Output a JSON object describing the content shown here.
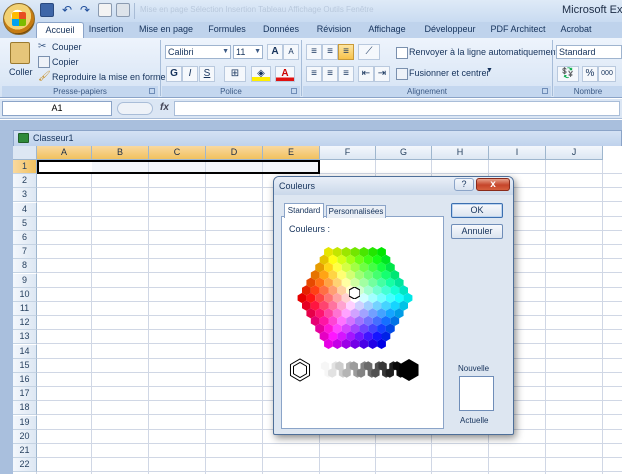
{
  "app": {
    "title": "Microsoft Exce",
    "faded_title": "Mise en page  Sélection  Insertion  Tableau  Affichage  Outils  Fenêtre"
  },
  "tabs": [
    {
      "label": "Accueil",
      "active": true
    },
    {
      "label": "Insertion"
    },
    {
      "label": "Mise en page"
    },
    {
      "label": "Formules"
    },
    {
      "label": "Données"
    },
    {
      "label": "Révision"
    },
    {
      "label": "Affichage"
    },
    {
      "label": "Développeur"
    },
    {
      "label": "PDF Architect"
    },
    {
      "label": "Acrobat"
    }
  ],
  "ribbon": {
    "clipboard": {
      "paste": "Coller",
      "cut": "Couper",
      "copy": "Copier",
      "format_painter": "Reproduire la mise en forme",
      "label": "Presse-papiers"
    },
    "font": {
      "name": "Calibri",
      "size": "11",
      "bold": "G",
      "italic": "I",
      "underline": "S",
      "grow": "A",
      "shrink": "A",
      "label": "Police"
    },
    "alignment": {
      "wrap": "Renvoyer à la ligne automatiquement",
      "merge": "Fusionner et centrer",
      "label": "Alignement"
    },
    "number": {
      "format": "Standard",
      "percent": "%",
      "thousands": "000",
      "label": "Nombre"
    }
  },
  "formula_bar": {
    "name_box": "A1",
    "fx": "fx"
  },
  "workbook": {
    "title": "Classeur1",
    "columns": [
      "A",
      "B",
      "C",
      "D",
      "E",
      "F",
      "G",
      "H",
      "I",
      "J"
    ],
    "rows": [
      "1",
      "2",
      "3",
      "4",
      "5",
      "6",
      "7",
      "8",
      "9",
      "10",
      "11",
      "12",
      "13",
      "14",
      "15",
      "16",
      "17",
      "18",
      "19",
      "20",
      "21",
      "22"
    ],
    "selected_columns": [
      "A",
      "B",
      "C",
      "D",
      "E"
    ],
    "selected_row": "1"
  },
  "dialog": {
    "title": "Couleurs",
    "help": "?",
    "close": "x",
    "tabs": {
      "standard": "Standard",
      "custom": "Personnalisées"
    },
    "colors_label": "Couleurs :",
    "ok": "OK",
    "cancel": "Annuler",
    "new_label": "Nouvelle",
    "current_label": "Actuelle"
  },
  "colors": {
    "selection_border": "#000000",
    "column_highlight": "#f1c15f",
    "close_button": "#c6452a"
  }
}
